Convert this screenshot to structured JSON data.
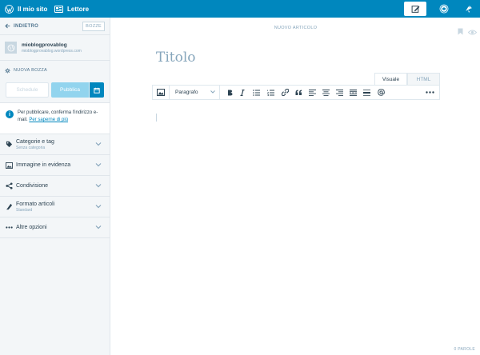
{
  "topbar": {
    "site_label": "Il mio sito",
    "reader_label": "Lettore",
    "icons": [
      "wordpress-icon",
      "reader-icon",
      "write-icon",
      "avatar-icon",
      "notifications-icon"
    ]
  },
  "sidebar": {
    "back_label": "INDIETRO",
    "drafts_label": "BOZZE",
    "site_name": "mioblogprovablog",
    "site_url": "mioblogprovablog.wordpress.com",
    "new_draft_label": "NUOVA BOZZA",
    "schedule_label": "Schedule",
    "publish_label": "Pubblica",
    "notice_text": "Per pubblicare, conferma l'indirizzo e-mail.",
    "notice_link": "Per saperne di più",
    "sections": [
      {
        "title": "Categorie e tag",
        "subtitle": "Senza categoria",
        "icon": "tag-icon"
      },
      {
        "title": "Immagine in evidenza",
        "subtitle": "",
        "icon": "image-icon"
      },
      {
        "title": "Condivisione",
        "subtitle": "",
        "icon": "share-icon"
      },
      {
        "title": "Formato articoli",
        "subtitle": "Standard",
        "icon": "post-format-icon"
      },
      {
        "title": "Altre opzioni",
        "subtitle": "",
        "icon": "ellipsis-icon"
      }
    ]
  },
  "editor": {
    "header_label": "NUOVO ARTICOLO",
    "title_placeholder": "Titolo",
    "tab_visual": "Visuale",
    "tab_html": "HTML",
    "format_value": "Paragrafo",
    "word_count": "0 PAROLE"
  },
  "colors": {
    "accent": "#0087be",
    "publish_disabled": "#92d4ee",
    "sidebar_bg": "#f3f6f8"
  }
}
